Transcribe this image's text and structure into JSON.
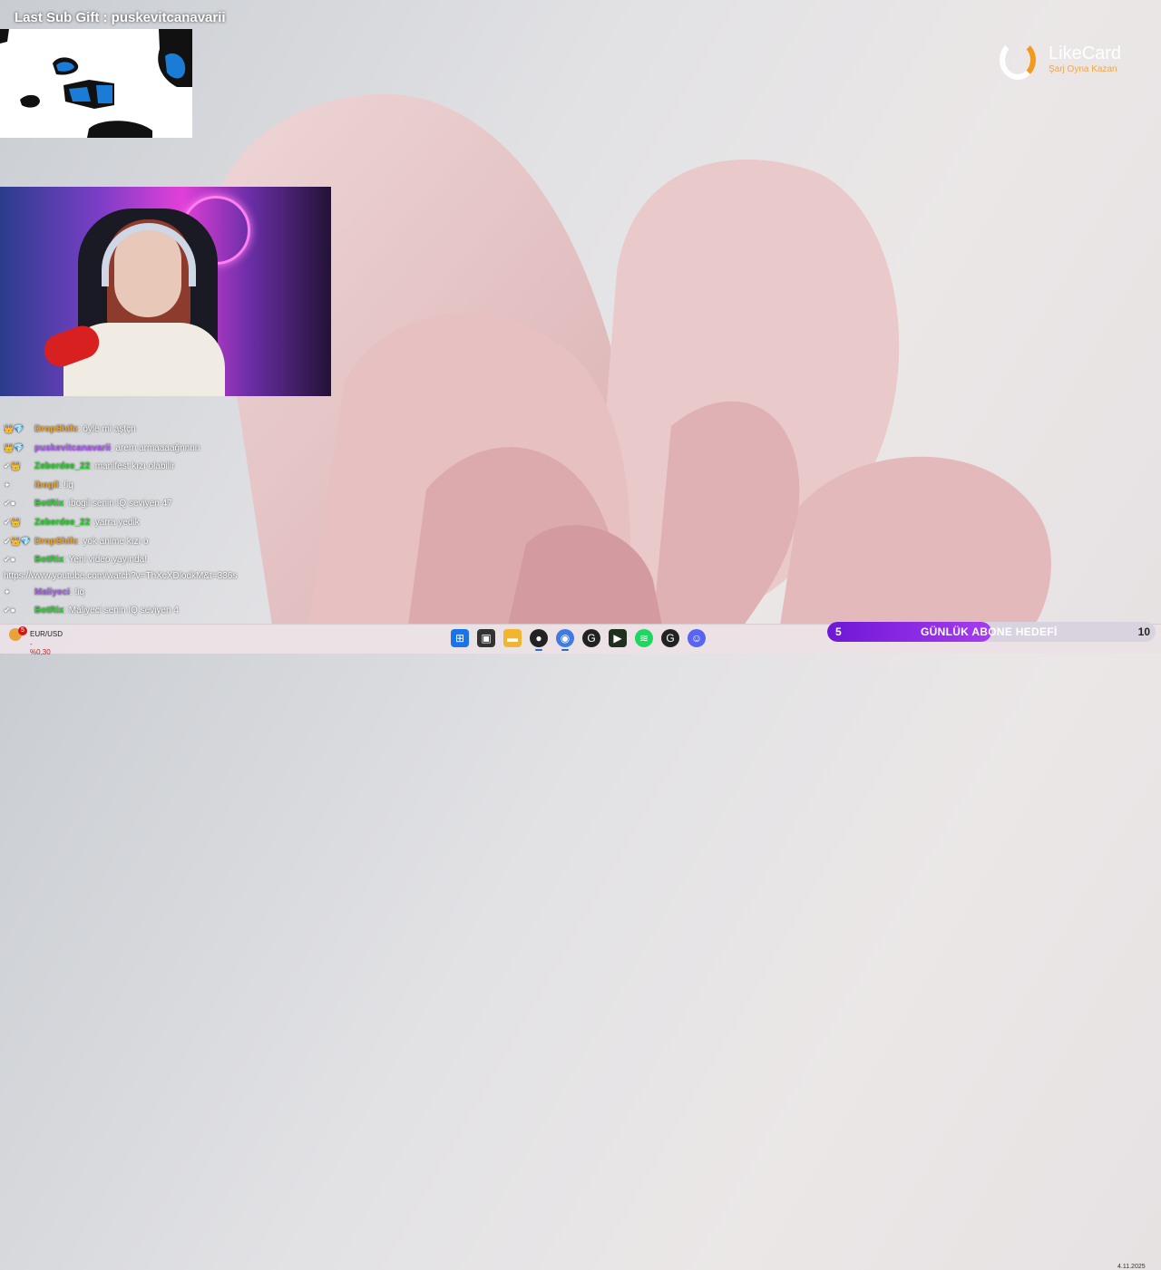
{
  "overlay": {
    "last_sub_gift": "Last Sub Gift : puskevitcanavarii"
  },
  "sponsor": {
    "name": "LikeCard",
    "tagline": "Şarj Oyna Kazan"
  },
  "chat": {
    "messages": [
      {
        "user": "DropShifc",
        "text": "öyle mi aştçn",
        "user_color": "#f0a020"
      },
      {
        "user": "puskevitcanavarii",
        "text": "arem armaaaağnnnn",
        "user_color": "#b45cff"
      },
      {
        "user": "Zeberdee_22",
        "text": "manifest kızı olabilir",
        "user_color": "#2fd32f"
      },
      {
        "user": "ibogil",
        "text": "!iq",
        "user_color": "#f0a020"
      },
      {
        "user": "BotRix",
        "text": "ibogil senin IQ seviyen 47",
        "user_color": "#2fd32f"
      },
      {
        "user": "Zeberdee_22",
        "text": "yarra yedik",
        "user_color": "#2fd32f"
      },
      {
        "user": "DropShifc",
        "text": "yok anime kızı o",
        "user_color": "#f0a020"
      },
      {
        "user": "BotRix",
        "text": "Yeni video yayında!",
        "user_color": "#2fd32f"
      }
    ],
    "link": "https://www.youtube.com/watch?v=ThXcXDlodkM&t=336s",
    "messages_after": [
      {
        "user": "Maliyeci",
        "text": "!iq",
        "user_color": "#b45cff"
      },
      {
        "user": "BotRix",
        "text": "Maliyeci senin IQ seviyen 4",
        "user_color": "#2fd32f"
      }
    ]
  },
  "taskbar": {
    "ticker_pair": "EUR/USD",
    "ticker_change": "-%0,30",
    "ticker_badge": "5",
    "icons": [
      {
        "name": "windows-start-icon",
        "color": "#1a73e8"
      },
      {
        "name": "task-view-icon",
        "color": "#333333"
      },
      {
        "name": "file-explorer-icon",
        "color": "#f2b531"
      },
      {
        "name": "obs-icon",
        "color": "#222222"
      },
      {
        "name": "chrome-icon",
        "color": "#3f7be0"
      },
      {
        "name": "g-app-icon",
        "color": "#222222"
      },
      {
        "name": "streaming-app-icon",
        "color": "#1f2f1f"
      },
      {
        "name": "spotify-icon",
        "color": "#1ed760"
      },
      {
        "name": "g-app-2-icon",
        "color": "#222222"
      },
      {
        "name": "discord-icon",
        "color": "#5865f2"
      }
    ],
    "clock_date": "4.11.2025"
  },
  "sub_goal": {
    "count": "5",
    "label": "GÜNLÜK ABONE HEDEFİ",
    "target": "10",
    "progress": 0.5
  }
}
